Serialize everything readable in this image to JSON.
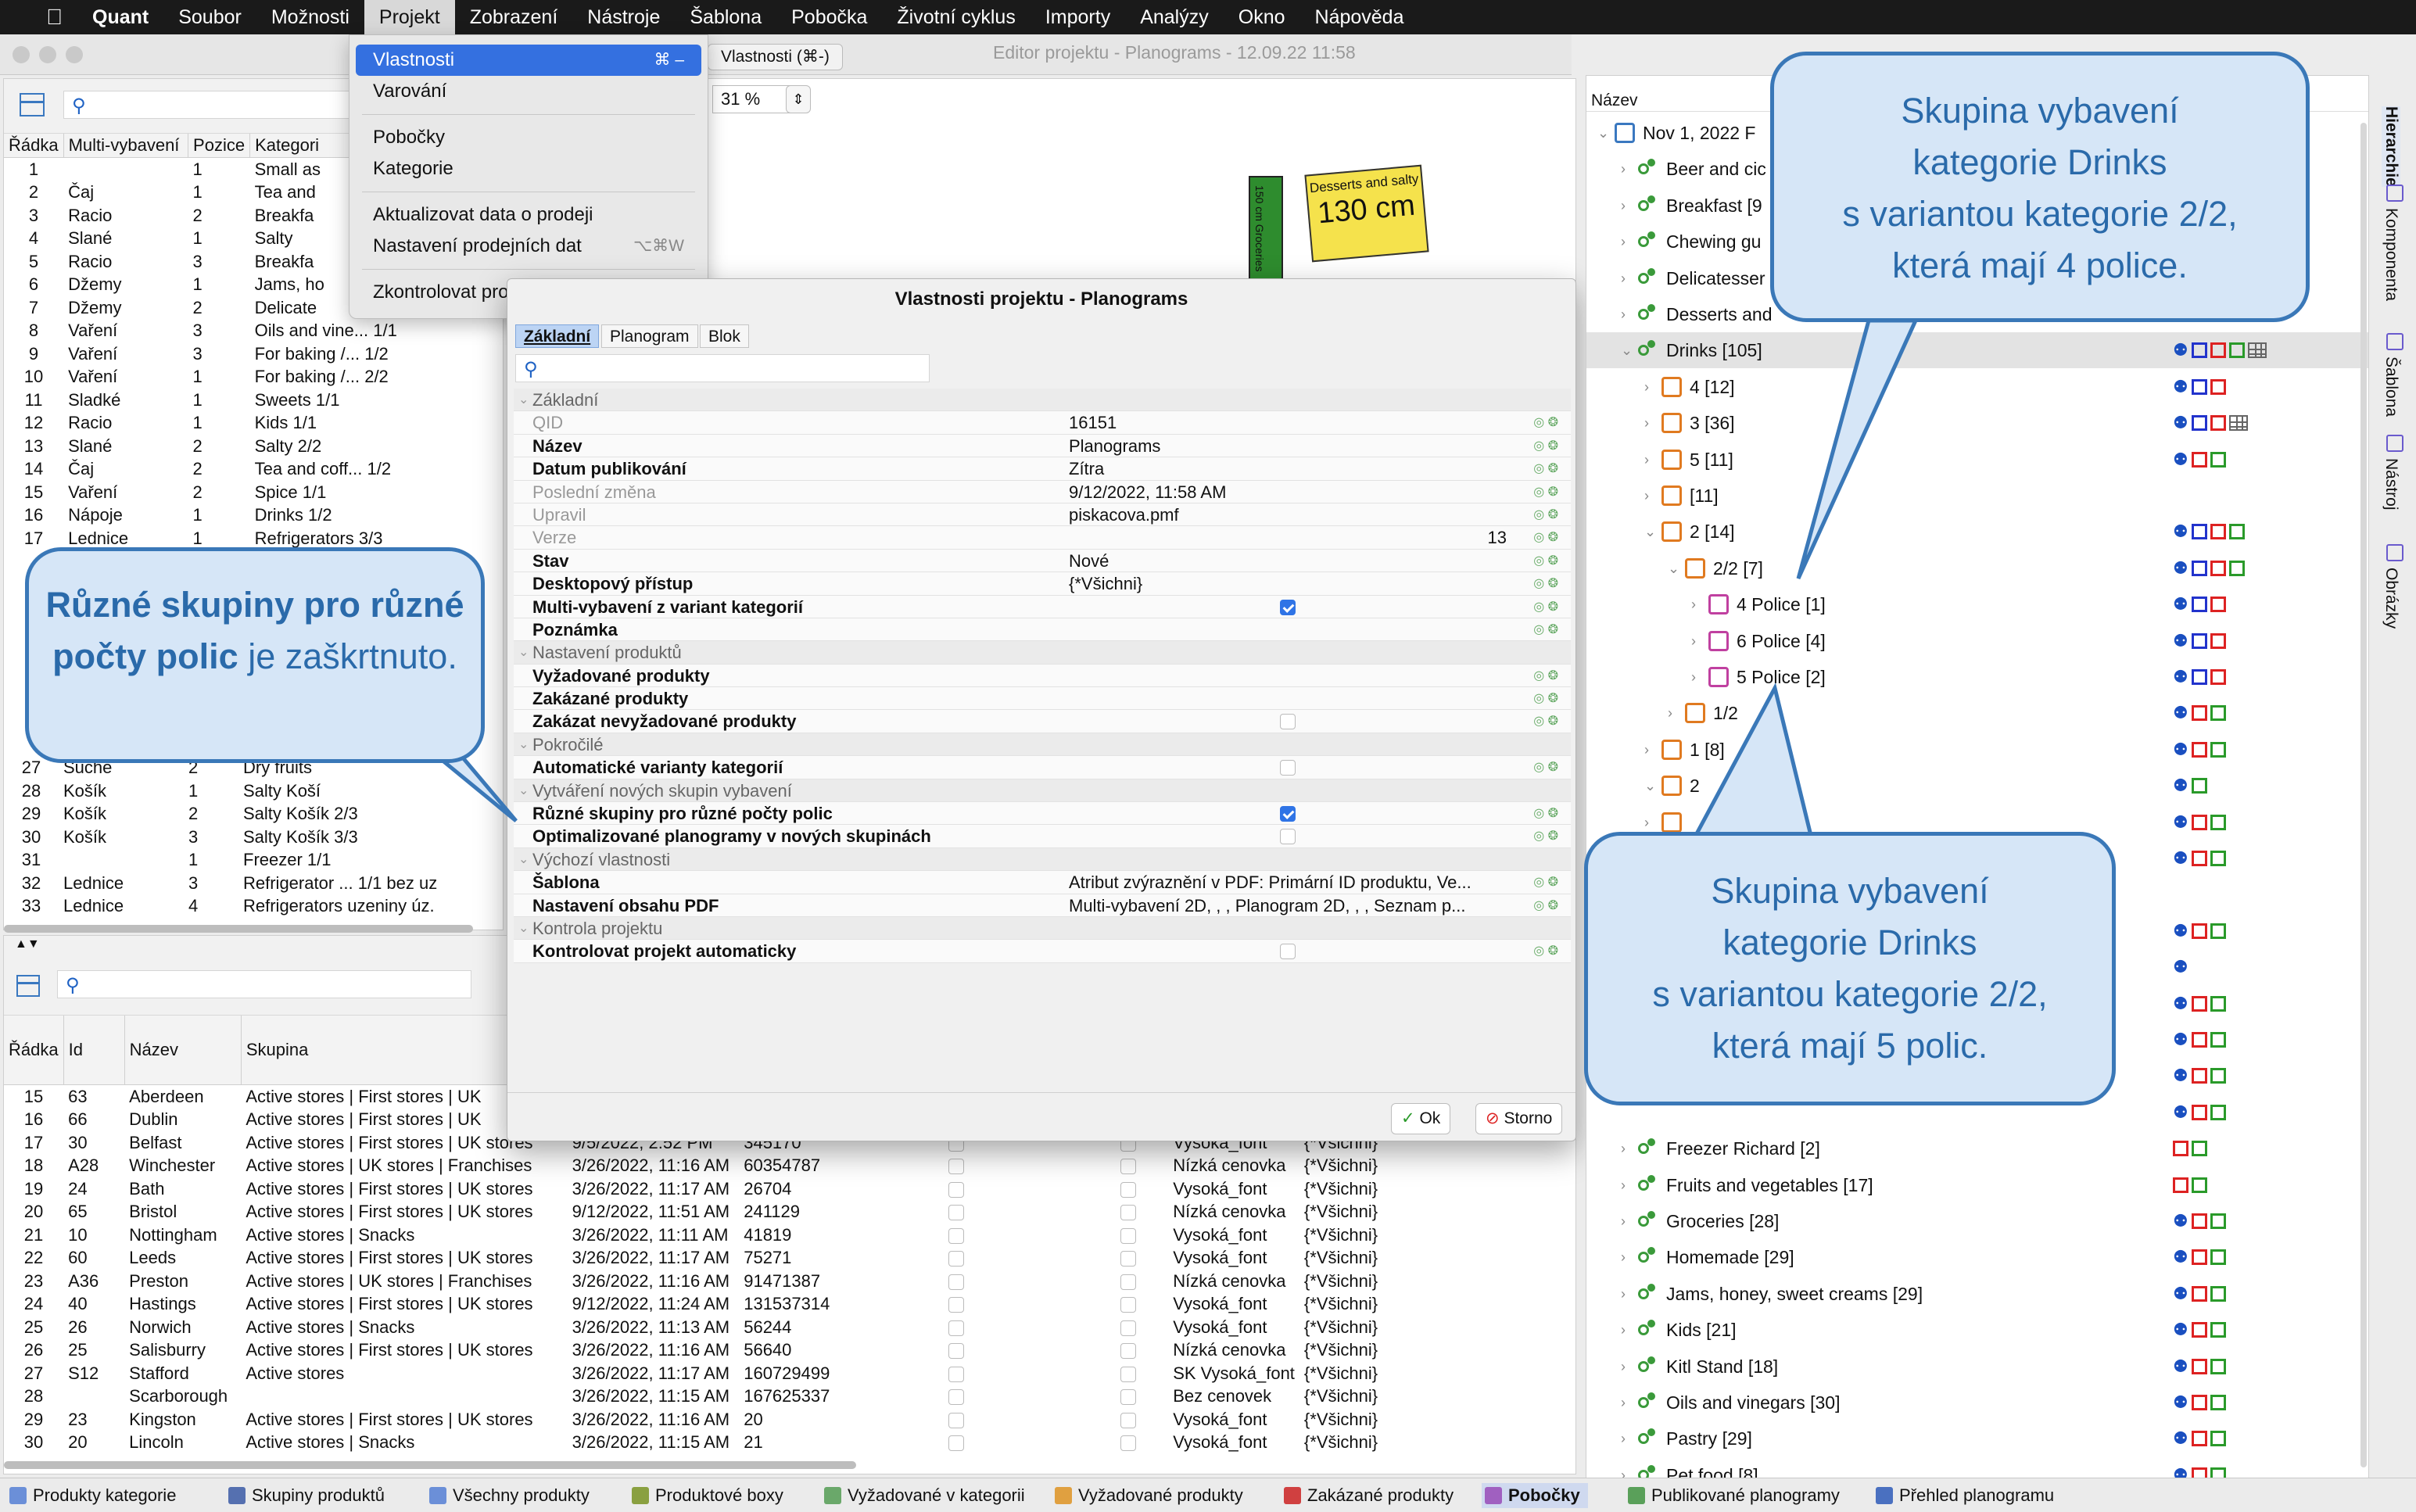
{
  "menubar": {
    "apple": "",
    "items": [
      "Quant",
      "Soubor",
      "Možnosti",
      "Projekt",
      "Zobrazení",
      "Nástroje",
      "Šablona",
      "Pobočka",
      "Životní cyklus",
      "Importy",
      "Analýzy",
      "Okno",
      "Nápověda"
    ]
  },
  "window": {
    "title": "Editor projektu - Planograms - 12.09.22 11:58",
    "tab_label": "Vlastnosti  (⌘-)",
    "zoom": "31 %"
  },
  "projekt_menu": {
    "items": [
      {
        "label": "Vlastnosti",
        "shortcut": "⌘ –",
        "selected": true
      },
      {
        "label": "Varování",
        "shortcut": ""
      },
      {
        "label": "Pobočky",
        "shortcut": ""
      },
      {
        "label": "Kategorie",
        "shortcut": ""
      },
      {
        "label": "Aktualizovat data o prodeji",
        "shortcut": ""
      },
      {
        "label": "Nastavení prodejních dat",
        "shortcut": "⌥⌘W"
      },
      {
        "label": "Zkontrolovat projekt",
        "shortcut": "⌘ K"
      }
    ]
  },
  "top_table": {
    "headers": [
      "Řádka",
      "Multi-vybavení",
      "Pozice",
      "Kategori"
    ],
    "rows": [
      [
        "1",
        "",
        "1",
        "Small as"
      ],
      [
        "2",
        "Čaj",
        "1",
        "Tea and"
      ],
      [
        "3",
        "Racio",
        "2",
        "Breakfa"
      ],
      [
        "4",
        "Slané",
        "1",
        "Salty"
      ],
      [
        "5",
        "Racio",
        "3",
        "Breakfa"
      ],
      [
        "6",
        "Džemy",
        "1",
        "Jams, ho"
      ],
      [
        "7",
        "Džemy",
        "2",
        "Delicate"
      ],
      [
        "8",
        "Vaření",
        "3",
        "Oils and vine... 1/1"
      ],
      [
        "9",
        "Vaření",
        "3",
        "For baking /... 1/2"
      ],
      [
        "10",
        "Vaření",
        "1",
        "For baking /... 2/2"
      ],
      [
        "11",
        "Sladké",
        "1",
        "Sweets          1/1"
      ],
      [
        "12",
        "Racio",
        "1",
        "Kids             1/1"
      ],
      [
        "13",
        "Slané",
        "2",
        "Salty            2/2"
      ],
      [
        "14",
        "Čaj",
        "2",
        "Tea and coff... 1/2"
      ],
      [
        "15",
        "Vaření",
        "2",
        "Spice            1/1"
      ],
      [
        "16",
        "Nápoje",
        "1",
        "Drinks           1/2"
      ],
      [
        "17",
        "Lednice",
        "1",
        "Refrigerators  3/3"
      ]
    ],
    "rows_lower": [
      [
        "27",
        "Suché",
        "2",
        "Dry fruits"
      ],
      [
        "28",
        "Košík",
        "1",
        "Salty    Koší"
      ],
      [
        "29",
        "Košík",
        "2",
        "Salty    Košík 2/3"
      ],
      [
        "30",
        "Košík",
        "3",
        "Salty    Košík 3/3"
      ],
      [
        "31",
        "",
        "1",
        "Freezer  1/1"
      ],
      [
        "32",
        "Lednice",
        "3",
        "Refrigerator ... 1/1 bez uz"
      ],
      [
        "33",
        "Lednice",
        "4",
        "Refrigerators  uzeniny úz."
      ]
    ]
  },
  "canvas": {
    "sign_title": "Desserts and salty",
    "sign_value": "130 cm",
    "green_label": "150 cm Groceries"
  },
  "dialog": {
    "title": "Vlastnosti projektu - Planograms",
    "tabs": [
      "Základní",
      "Planogram",
      "Blok"
    ],
    "rows": [
      {
        "k": "Základní",
        "sec": true
      },
      {
        "k": "QID",
        "v": "16151",
        "dim": true
      },
      {
        "k": "Název",
        "v": "Planograms"
      },
      {
        "k": "Datum publikování",
        "v": "Zítra"
      },
      {
        "k": "Poslední změna",
        "v": "9/12/2022, 11:58 AM",
        "dim": true
      },
      {
        "k": "Upravil",
        "v": "piskacova.pmf",
        "dim": true
      },
      {
        "k": "Verze",
        "v": "13",
        "dim": true,
        "right": true
      },
      {
        "k": "Stav",
        "v": "Nové"
      },
      {
        "k": "Desktopový přístup",
        "v": "{*Všichni}"
      },
      {
        "k": "Multi-vybavení z variant kategorií",
        "cb": true
      },
      {
        "k": "Poznámka",
        "v": ""
      },
      {
        "k": "Nastavení produktů",
        "sec": true
      },
      {
        "k": "Vyžadované produkty",
        "v": ""
      },
      {
        "k": "Zakázané produkty",
        "v": ""
      },
      {
        "k": "Zakázat nevyžadované produkty",
        "cb": false
      },
      {
        "k": "Pokročilé",
        "sec": true
      },
      {
        "k": "Automatické varianty kategorií",
        "cb": false
      },
      {
        "k": "Vytváření nových skupin vybavení",
        "sec": true
      },
      {
        "k": "Různé skupiny pro různé počty polic",
        "cb": true
      },
      {
        "k": "Optimalizované planogramy v nových skupinách",
        "cb": false
      },
      {
        "k": "Výchozí vlastnosti",
        "sec": true
      },
      {
        "k": "Šablona",
        "v": "Atribut zvýraznění v PDF: Primární ID produktu, Ve..."
      },
      {
        "k": "Nastavení obsahu PDF",
        "v": "Multi-vybavení 2D, , , Planogram 2D, , , Seznam p..."
      },
      {
        "k": "Kontrola projektu",
        "sec": true
      },
      {
        "k": "Kontrolovat projekt automaticky",
        "cb": false
      }
    ],
    "ok": "Ok",
    "cancel": "Storno"
  },
  "bottom_table": {
    "headers": [
      "Řádka",
      "Id",
      "Název",
      "Skupina"
    ],
    "rows": [
      [
        "15",
        "63",
        "Aberdeen",
        "Active stores | First stores | UK",
        "",
        "",
        "",
        "",
        ""
      ],
      [
        "16",
        "66",
        "Dublin",
        "Active stores | First stores | UK",
        "",
        "",
        "",
        "",
        ""
      ],
      [
        "17",
        "30",
        "Belfast",
        "Active stores | First stores | UK stores",
        "9/5/2022, 2:52 PM",
        "345170",
        "Vysoká_font",
        "{*Všichni}"
      ],
      [
        "18",
        "A28",
        "Winchester",
        "Active stores | UK stores | Franchises",
        "3/26/2022, 11:16 AM",
        "60354787",
        "Nízká cenovka",
        "{*Všichni}"
      ],
      [
        "19",
        "24",
        "Bath",
        "Active stores | First stores | UK stores",
        "3/26/2022, 11:17 AM",
        "26704",
        "Vysoká_font",
        "{*Všichni}"
      ],
      [
        "20",
        "65",
        "Bristol",
        "Active stores | First stores | UK stores",
        "9/12/2022, 11:51 AM",
        "241129",
        "Nízká cenovka",
        "{*Všichni}"
      ],
      [
        "21",
        "10",
        "Nottingham",
        "Active stores | Snacks",
        "3/26/2022, 11:11 AM",
        "41819",
        "Vysoká_font",
        "{*Všichni}"
      ],
      [
        "22",
        "60",
        "Leeds",
        "Active stores | First stores | UK stores",
        "3/26/2022, 11:17 AM",
        "75271",
        "Vysoká_font",
        "{*Všichni}"
      ],
      [
        "23",
        "A36",
        "Preston",
        "Active stores | UK stores | Franchises",
        "3/26/2022, 11:16 AM",
        "91471387",
        "Nízká cenovka",
        "{*Všichni}"
      ],
      [
        "24",
        "40",
        "Hastings",
        "Active stores | First stores | UK stores",
        "9/12/2022, 11:24 AM",
        "131537314",
        "Vysoká_font",
        "{*Všichni}"
      ],
      [
        "25",
        "26",
        "Norwich",
        "Active stores | Snacks",
        "3/26/2022, 11:13 AM",
        "56244",
        "Vysoká_font",
        "{*Všichni}"
      ],
      [
        "26",
        "25",
        "Salisburry",
        "Active stores | First stores | UK stores",
        "3/26/2022, 11:16 AM",
        "56640",
        "Nízká cenovka",
        "{*Všichni}"
      ],
      [
        "27",
        "S12",
        "Stafford",
        "Active stores",
        "3/26/2022, 11:17 AM",
        "160729499",
        "SK Vysoká_font",
        "{*Všichni}"
      ],
      [
        "28",
        "",
        "Scarborough",
        "",
        "3/26/2022, 11:15 AM",
        "167625337",
        "Bez cenovek",
        "{*Všichni}"
      ],
      [
        "29",
        "23",
        "Kingston",
        "Active stores | First stores | UK stores",
        "3/26/2022, 11:16 AM",
        "20",
        "Vysoká_font",
        "{*Všichni}"
      ],
      [
        "30",
        "20",
        "Lincoln",
        "Active stores | Snacks",
        "3/26/2022, 11:15 AM",
        "21",
        "Vysoká_font",
        "{*Všichni}"
      ]
    ]
  },
  "tree": {
    "header": "Název",
    "rows": [
      {
        "label": "Nov 1, 2022 F",
        "level": 0,
        "icon": "root",
        "icons": ""
      },
      {
        "label": "Beer and cic",
        "level": 1,
        "icon": "net",
        "icons": ""
      },
      {
        "label": "Breakfast [9",
        "level": 1,
        "icon": "net",
        "icons": ""
      },
      {
        "label": "Chewing gu",
        "level": 1,
        "icon": "net",
        "icons": ""
      },
      {
        "label": "Delicatesser",
        "level": 1,
        "icon": "net",
        "icons": ""
      },
      {
        "label": "Desserts and",
        "level": 1,
        "icon": "net",
        "icons": ""
      },
      {
        "label": "Drinks [105]",
        "level": 1,
        "icon": "net",
        "icons": "lbrgG",
        "sel": true
      },
      {
        "label": "4 [12]",
        "level": 2,
        "icon": "shelf",
        "icons": "lbr"
      },
      {
        "label": "3 [36]",
        "level": 2,
        "icon": "shelf",
        "icons": "lbrG"
      },
      {
        "label": "5 [11]",
        "level": 2,
        "icon": "shelf",
        "icons": "lrg"
      },
      {
        "label": " [11]",
        "level": 2,
        "icon": "shelf",
        "icons": ""
      },
      {
        "label": "2 [14]",
        "level": 2,
        "icon": "shelf",
        "icons": "lbrg"
      },
      {
        "label": "2/2 [7]",
        "level": 3,
        "icon": "var",
        "icons": "lbrg"
      },
      {
        "label": "4 Police [1]",
        "level": 4,
        "icon": "pol",
        "icons": "lbr"
      },
      {
        "label": "6 Police [4]",
        "level": 4,
        "icon": "pol",
        "icons": "lbr"
      },
      {
        "label": "5 Police [2]",
        "level": 4,
        "icon": "pol",
        "icons": "lbr"
      },
      {
        "label": "1/2",
        "level": 3,
        "icon": "var",
        "icons": "lrg"
      },
      {
        "label": "1 [8]",
        "level": 2,
        "icon": "shelf",
        "icons": "lrg"
      },
      {
        "label": "2",
        "level": 2,
        "icon": "shelf",
        "icons": "lg"
      },
      {
        "label": "",
        "level": 2,
        "icon": "shelf",
        "icons": "lrg"
      },
      {
        "label": "",
        "level": 2,
        "icon": "none",
        "icons": "lrg"
      },
      {
        "label": "",
        "level": 2,
        "icon": "none",
        "icons": ""
      },
      {
        "label": "",
        "level": 2,
        "icon": "none",
        "icons": "lrg"
      },
      {
        "label": "",
        "level": 2,
        "icon": "none",
        "icons": "l"
      },
      {
        "label": "",
        "level": 2,
        "icon": "none",
        "icons": "lrg"
      },
      {
        "label": "",
        "level": 2,
        "icon": "none",
        "icons": "lrg"
      },
      {
        "label": "",
        "level": 2,
        "icon": "none",
        "icons": "lrg"
      },
      {
        "label": "",
        "level": 2,
        "icon": "none",
        "icons": "lrg"
      },
      {
        "label": "Freezer Richard [2]",
        "level": 1,
        "icon": "net",
        "icons": "rg"
      },
      {
        "label": "Fruits and vegetables [17]",
        "level": 1,
        "icon": "net",
        "icons": "rg"
      },
      {
        "label": "Groceries [28]",
        "level": 1,
        "icon": "net",
        "icons": "lrg"
      },
      {
        "label": "Homemade [29]",
        "level": 1,
        "icon": "net",
        "icons": "lrg"
      },
      {
        "label": "Jams, honey, sweet creams [29]",
        "level": 1,
        "icon": "net",
        "icons": "lrg"
      },
      {
        "label": "Kids [21]",
        "level": 1,
        "icon": "net",
        "icons": "lrg"
      },
      {
        "label": "Kitl Stand [18]",
        "level": 1,
        "icon": "net",
        "icons": "lrg"
      },
      {
        "label": "Oils and vinegars [30]",
        "level": 1,
        "icon": "net",
        "icons": "lrg"
      },
      {
        "label": "Pastry [29]",
        "level": 1,
        "icon": "net",
        "icons": "lrg"
      },
      {
        "label": "Pet food [8]",
        "level": 1,
        "icon": "net",
        "icons": "lrg"
      }
    ]
  },
  "side_tabs": [
    "Hierarchie",
    "Komponenta",
    "Šablona",
    "Nástroj",
    "Obrázky"
  ],
  "bottom_tabs": [
    {
      "label": "Produkty kategorie",
      "color": "#6b8fd8"
    },
    {
      "label": "Skupiny produktů",
      "color": "#5570b0"
    },
    {
      "label": "Všechny produkty",
      "color": "#6b8fd8"
    },
    {
      "label": "Produktové boxy",
      "color": "#8aa040"
    },
    {
      "label": "Vyžadované v kategorii",
      "color": "#6aa86a"
    },
    {
      "label": "Vyžadované produkty",
      "color": "#e0a040"
    },
    {
      "label": "Zakázané produkty",
      "color": "#d04040"
    },
    {
      "label": "Pobočky",
      "color": "#a060c0",
      "active": true
    },
    {
      "label": "Publikované planogramy",
      "color": "#5aa05a"
    },
    {
      "label": "Přehled planogramu",
      "color": "#4a70c0"
    }
  ],
  "callouts": {
    "left_bold": "Různé skupiny pro různé počty polic",
    "left_rest": " je zaškrtnuto.",
    "top_right": [
      "Skupina vybavení",
      "kategorie Drinks",
      "s variantou kategorie 2/2,",
      "která mají 4 police."
    ],
    "bottom_right": [
      "Skupina vybavení",
      "kategorie Drinks",
      "s variantou kategorie 2/2,",
      "která mají 5 polic."
    ]
  }
}
